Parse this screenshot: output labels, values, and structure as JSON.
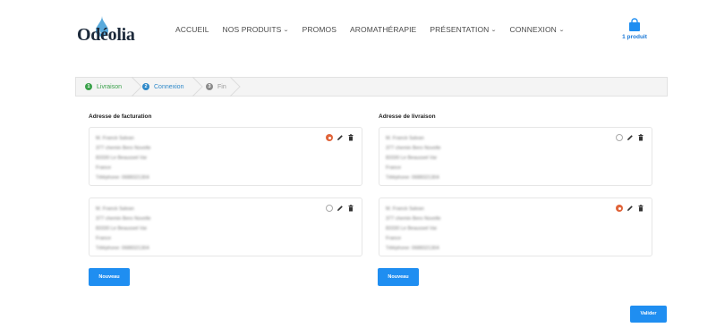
{
  "brand": {
    "name": "Odéolia",
    "accent": "#1f8ef1",
    "drop_color": "#3b9bd6"
  },
  "nav": {
    "items": [
      {
        "label": "ACCUEIL",
        "dropdown": false
      },
      {
        "label": "NOS PRODUITS",
        "dropdown": true
      },
      {
        "label": "PROMOS",
        "dropdown": false
      },
      {
        "label": "AROMATHÉRAPIE",
        "dropdown": false
      },
      {
        "label": "PRÉSENTATION",
        "dropdown": true
      },
      {
        "label": "CONNEXION",
        "dropdown": true
      }
    ],
    "chevron": "⌄"
  },
  "cart": {
    "icon": "shopping-bag-icon",
    "label": "1 produit"
  },
  "steps": [
    {
      "number": "1",
      "label": "Livraison",
      "state": "done"
    },
    {
      "number": "2",
      "label": "Connexion",
      "state": "active"
    },
    {
      "number": "3",
      "label": "Fin",
      "state": "pending"
    }
  ],
  "billing": {
    "title": "Adresse de facturation",
    "addresses": [
      {
        "lines": [
          "M. Franck Salvan",
          "377 chemin Bero Novelle",
          "83330 Le Beausset Var",
          "France",
          "Téléphone: 0688321304"
        ],
        "selected": true
      },
      {
        "lines": [
          "M. Franck Salvan",
          "377 chemin Bero Novelle",
          "83330 Le Beausset Var",
          "France",
          "Téléphone: 0688321304"
        ],
        "selected": false
      }
    ],
    "new_button": "Nouveau"
  },
  "shipping": {
    "title": "Adresse de livraison",
    "addresses": [
      {
        "lines": [
          "M. Franck Salvan",
          "377 chemin Bero Novelle",
          "83330 Le Beausset Var",
          "France",
          "Téléphone: 0688321304"
        ],
        "selected": false
      },
      {
        "lines": [
          "M. Franck Salvan",
          "377 chemin Bero Novelle",
          "83330 Le Beausset Var",
          "France",
          "Téléphone: 0688321304"
        ],
        "selected": true
      }
    ],
    "new_button": "Nouveau"
  },
  "validate_button": "Valider",
  "colors": {
    "selected_radio": "#e0643a",
    "step_done": "#3aa14a",
    "step_active": "#2e89c9",
    "step_pending": "#8a8a8a"
  }
}
